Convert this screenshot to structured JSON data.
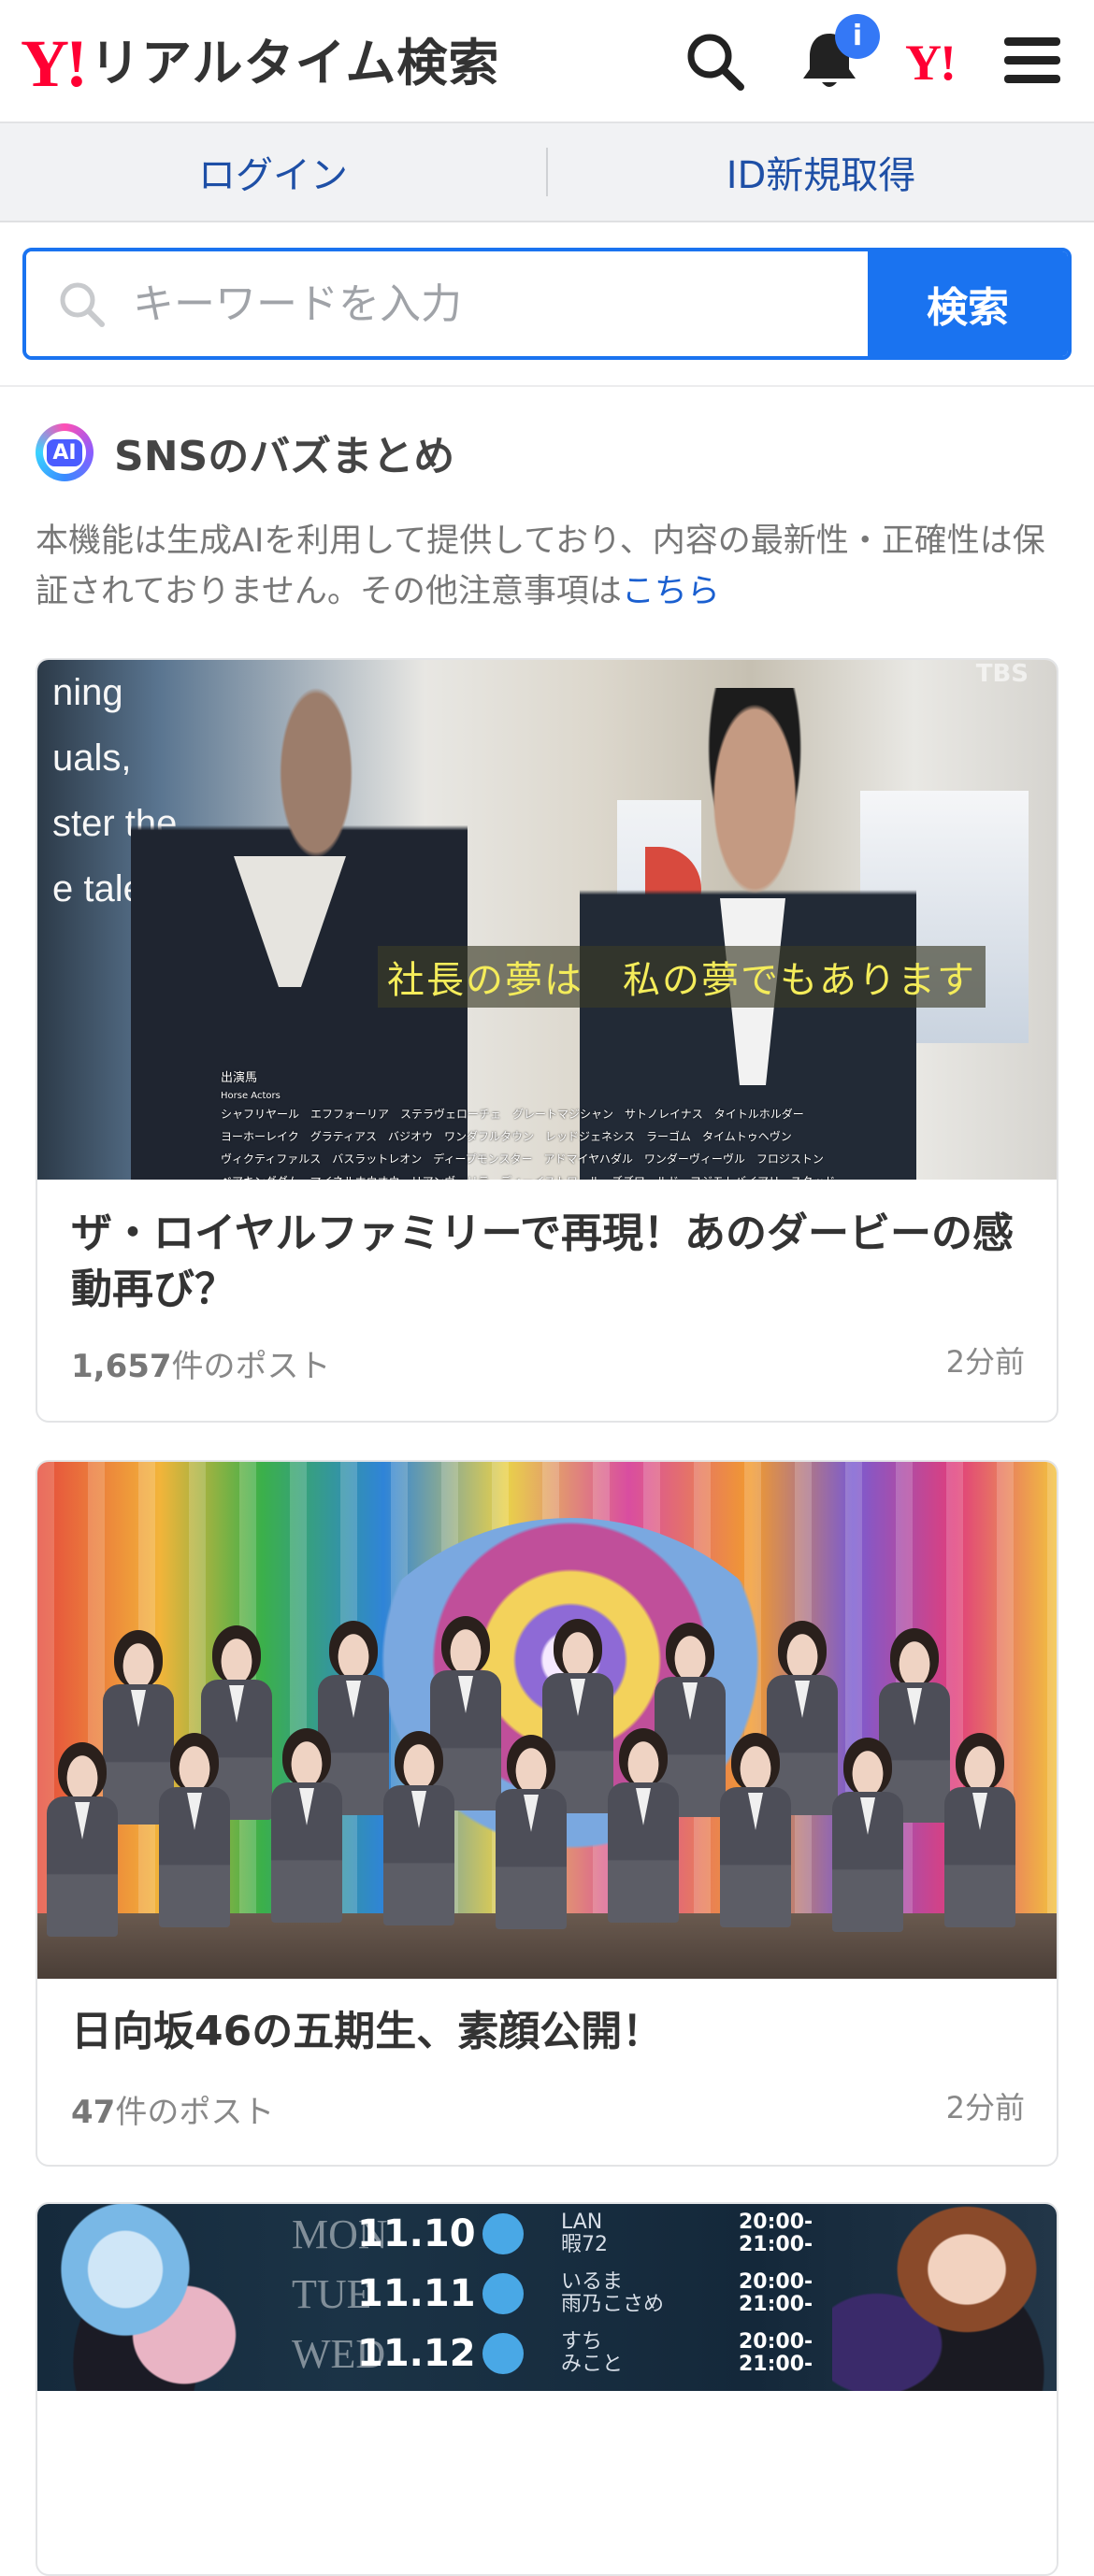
{
  "header": {
    "logo_text": "Y!",
    "title": "リアルタイム検索",
    "notification_badge": "i",
    "yahoo_mark": "Y!"
  },
  "account": {
    "login_label": "ログイン",
    "register_label": "ID新規取得"
  },
  "search": {
    "placeholder": "キーワードを入力",
    "button_label": "検索"
  },
  "section": {
    "ai_badge": "AI",
    "title": "SNSのバズまとめ",
    "notice_text": "本機能は生成AIを利用して提供しており、内容の最新性・正確性は保証されておりません。その他注意事項は",
    "notice_link": "こちら"
  },
  "cards": [
    {
      "title": "ザ・ロイヤルファミリーで再現！あのダービーの感動再び？",
      "post_count": "1,657",
      "post_suffix": "件のポスト",
      "time": "2分前",
      "image": {
        "subtitle": "社長の夢は　私の夢でもあります",
        "wall_text": [
          "ning",
          "uals,",
          "ster the",
          "e talent"
        ],
        "channel_mark": "TBS",
        "credits_title": "出演馬",
        "credits_subtitle": "Horse Actors",
        "credits_lines": [
          "シャフリヤール　エフフォーリア　ステラヴェローチェ　グレートマジシャン　サトノレイナス　タイトルホルダー",
          "ヨーホーレイク　グラティアス　バジオウ　ワンダフルタウン　レッドジェネシス　ラーゴム　タイムトゥヘヴン",
          "ヴィクティファルス　バスラットレオン　ディープモンスター　アドマイヤハダル　ワンダーヴィーヴル　フロジストン",
          "ベアキングダム　マイネルホウオウ　リアンヴェリテ　ディーイストワール　ズズワールド　フジモトバイアリースタッド"
        ]
      }
    },
    {
      "title": "日向坂46の五期生、素顔公開！",
      "post_count": "47",
      "post_suffix": "件のポスト",
      "time": "2分前"
    },
    {
      "image": {
        "schedule": [
          {
            "day": "MON",
            "date": "11.10",
            "names": [
              "LAN",
              "暇72"
            ],
            "times": [
              "20:00-",
              "21:00-"
            ]
          },
          {
            "day": "TUE",
            "date": "11.11",
            "names": [
              "いるま",
              "雨乃こさめ"
            ],
            "times": [
              "20:00-",
              "21:00-"
            ]
          },
          {
            "day": "WED",
            "date": "11.12",
            "names": [
              "すち",
              "みこと"
            ],
            "times": [
              "20:00-",
              "21:00-"
            ]
          }
        ]
      }
    }
  ]
}
